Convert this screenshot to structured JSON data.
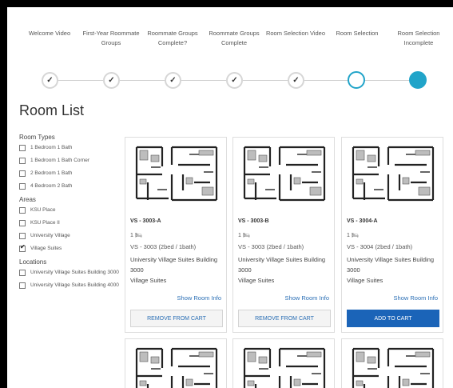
{
  "steps": [
    {
      "label": "Welcome Video",
      "state": "done"
    },
    {
      "label": "First-Year Roommate Groups",
      "state": "done"
    },
    {
      "label": "Roommate Groups Complete?",
      "state": "done"
    },
    {
      "label": "Roommate Groups Complete",
      "state": "done"
    },
    {
      "label": "Room Selection Video",
      "state": "done"
    },
    {
      "label": "Room Selection",
      "state": "current"
    },
    {
      "label": "Room Selection Incomplete",
      "state": "filled"
    }
  ],
  "check_glyph": "✓",
  "page_title": "Room List",
  "filters": {
    "room_types": {
      "heading": "Room Types",
      "options": [
        {
          "label": "1 Bedroom 1 Bath",
          "checked": false
        },
        {
          "label": "1 Bedroom 1 Bath Corner",
          "checked": false
        },
        {
          "label": "2 Bedroom 1 Bath",
          "checked": false
        },
        {
          "label": "4 Bedroom 2 Bath",
          "checked": false
        }
      ]
    },
    "areas": {
      "heading": "Areas",
      "options": [
        {
          "label": "KSU Place",
          "checked": false
        },
        {
          "label": "KSU Place II",
          "checked": false
        },
        {
          "label": "University Village",
          "checked": false
        },
        {
          "label": "Village Suites",
          "checked": true
        }
      ]
    },
    "locations": {
      "heading": "Locations",
      "options": [
        {
          "label": "University Village Suites Building 3000",
          "checked": false
        },
        {
          "label": "University Village Suites Building 4000",
          "checked": false
        }
      ]
    }
  },
  "cards": [
    {
      "code": "VS - 3003-A",
      "beds": "1",
      "type": "VS - 3003 (2bed / 1bath)",
      "building": "University Village Suites Building 3000",
      "area": "Village Suites",
      "info_link": "Show Room Info",
      "button": "REMOVE FROM CART",
      "in_cart": true
    },
    {
      "code": "VS - 3003-B",
      "beds": "1",
      "type": "VS - 3003 (2bed / 1bath)",
      "building": "University Village Suites Building 3000",
      "area": "Village Suites",
      "info_link": "Show Room Info",
      "button": "REMOVE FROM CART",
      "in_cart": true
    },
    {
      "code": "VS - 3004-A",
      "beds": "1",
      "type": "VS - 3004 (2bed / 1bath)",
      "building": "University Village Suites Building 3000",
      "area": "Village Suites",
      "info_link": "Show Room Info",
      "button": "ADD TO CART",
      "in_cart": false
    }
  ],
  "colors": {
    "accent": "#21a4c9",
    "primary_button": "#1b64b8",
    "link": "#2b6fb5"
  }
}
